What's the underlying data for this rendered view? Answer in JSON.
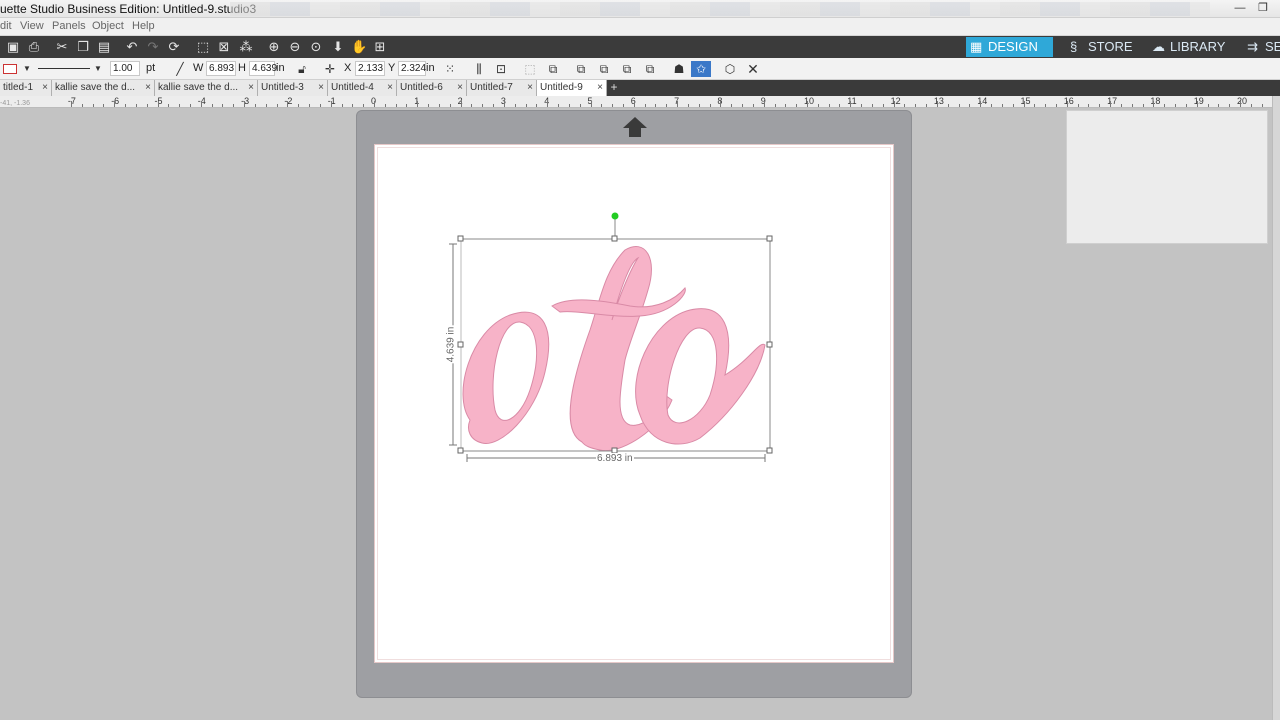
{
  "window": {
    "title": "uette Studio Business Edition: Untitled-9.studio3",
    "minimize_glyph": "—",
    "maximize_glyph": "❐"
  },
  "menu": [
    "dit",
    "View",
    "Panels",
    "Object",
    "Help"
  ],
  "nav_tabs": [
    {
      "label": "DESIGN",
      "icon": "grid-icon"
    },
    {
      "label": "STORE",
      "icon": "store-icon"
    },
    {
      "label": "LIBRARY",
      "icon": "cloud-icon"
    },
    {
      "label": "SE",
      "icon": "send-icon"
    }
  ],
  "line_width": {
    "value": "1.00",
    "unit": "pt"
  },
  "size": {
    "w_label": "W",
    "w_value": "6.893",
    "h_label": "H",
    "h_value": "4.639",
    "unit": "in"
  },
  "position": {
    "x_label": "X",
    "x_value": "2.133",
    "y_label": "Y",
    "y_value": "2.324",
    "unit": "in"
  },
  "doc_tabs": [
    {
      "label": "titled-1",
      "active": false
    },
    {
      "label": "kallie save the d...",
      "active": false
    },
    {
      "label": "kallie save the d...",
      "active": false
    },
    {
      "label": "Untitled-3",
      "active": false
    },
    {
      "label": "Untitled-4",
      "active": false
    },
    {
      "label": "Untitled-6",
      "active": false
    },
    {
      "label": "Untitled-7",
      "active": false
    },
    {
      "label": "Untitled-9",
      "active": true
    }
  ],
  "add_tab_label": "+",
  "close_tab_glyph": "×",
  "ruler": {
    "labels": [
      "-7",
      "-6",
      "-5",
      "-4",
      "-3",
      "-2",
      "-1",
      "0",
      "1",
      "2",
      "3",
      "4",
      "5",
      "6",
      "7",
      "8",
      "9",
      "10",
      "11",
      "12",
      "13",
      "14",
      "15",
      "16",
      "17",
      "18",
      "19",
      "20"
    ],
    "corner_readout": "-41, -1.36"
  },
  "selection": {
    "width_label": "6.893 in",
    "height_label": "4.639 in"
  },
  "colors": {
    "accent": "#2fa8d8",
    "design_fill": "#f7b3c8",
    "design_stroke": "#d98aa6",
    "mat": "#9e9fa3",
    "handle_rotate": "#22cc22"
  }
}
